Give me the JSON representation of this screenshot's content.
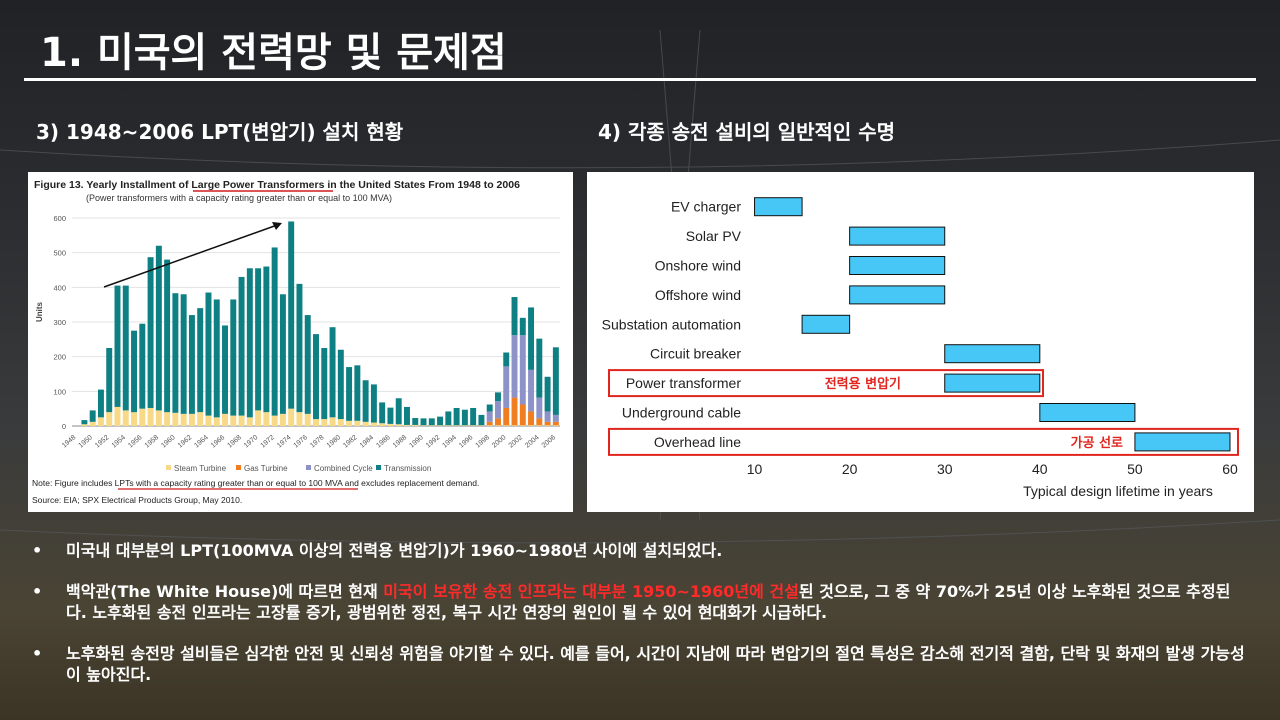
{
  "slide": {
    "title": "1. 미국의 전력망 및 문제점",
    "left_heading": "3)  1948~2006 LPT(변압기) 설치 현황",
    "right_heading": "4)  각종 송전 설비의 일반적인 수명"
  },
  "bullets": [
    {
      "pre": "미국내 대부분의 LPT(100MVA 이상의 전력용 변압기)가 1960~1980년 사이에 설치되었다.",
      "highlight": "",
      "post": ""
    },
    {
      "pre": "백악관(The White House)에 따르면 현재 ",
      "highlight": "미국이 보유한 송전 인프라는 대부분 1950~1960년에 건설",
      "post": "된 것으로, 그 중 약 70%가 25년 이상 노후화된 것으로 추정된다. 노후화된 송전 인프라는 고장률 증가, 광범위한 정전, 복구 시간 연장의 원인이 될 수 있어 현대화가 시급하다."
    },
    {
      "pre": "노후화된 송전망 설비들은 심각한 안전 및 신뢰성 위험을 야기할 수 있다. 예를 들어, 시간이 지남에 따라 변압기의 절연 특성은 감소해 전기적 결함, 단락 및 화재의 발생 가능성이 높아진다.",
      "highlight": "",
      "post": ""
    }
  ],
  "bullet_symbol": "•",
  "colors": {
    "teal": "#0e8083",
    "tan": "#f7d987",
    "orange": "#f07d1f",
    "purple": "#8d93c9",
    "cyan": "#46c7f5",
    "red": "#e0261f"
  },
  "chart_data": [
    {
      "type": "bar",
      "stacked": true,
      "title_pre": "Figure 13. Yearly Installment of ",
      "title_link": "Large Power Transformers",
      "title_post": " in the United States From 1948 to 2006",
      "subtitle": "(Power transformers with a capacity rating greater than or equal to 100 MVA)",
      "ylabel": "Units",
      "ylim": [
        0,
        600
      ],
      "yticks": [
        0,
        100,
        200,
        300,
        400,
        500,
        600
      ],
      "x": [
        1948,
        1949,
        1950,
        1951,
        1952,
        1953,
        1954,
        1955,
        1956,
        1957,
        1958,
        1959,
        1960,
        1961,
        1962,
        1963,
        1964,
        1965,
        1966,
        1967,
        1968,
        1969,
        1970,
        1971,
        1972,
        1973,
        1974,
        1975,
        1976,
        1977,
        1978,
        1979,
        1980,
        1981,
        1982,
        1983,
        1984,
        1985,
        1986,
        1987,
        1988,
        1989,
        1990,
        1991,
        1992,
        1993,
        1994,
        1995,
        1996,
        1997,
        1998,
        1999,
        2000,
        2001,
        2002,
        2003,
        2004,
        2005,
        2006
      ],
      "xtick_labels": [
        "1948",
        "1950",
        "1952",
        "1954",
        "1956",
        "1958",
        "1960",
        "1962",
        "1964",
        "1966",
        "1968",
        "1970",
        "1972",
        "1974",
        "1976",
        "1978",
        "1980",
        "1982",
        "1984",
        "1986",
        "1988",
        "1990",
        "1992",
        "1994",
        "1996",
        "1998",
        "2000",
        "2002",
        "2004",
        "2006"
      ],
      "series": [
        {
          "name": "Steam Turbine",
          "values": [
            0,
            5,
            12,
            25,
            40,
            55,
            45,
            40,
            50,
            52,
            45,
            40,
            38,
            35,
            35,
            40,
            30,
            25,
            35,
            30,
            30,
            25,
            45,
            40,
            30,
            35,
            50,
            40,
            35,
            20,
            20,
            25,
            20,
            15,
            15,
            12,
            10,
            8,
            6,
            5,
            3,
            3,
            2,
            2,
            2,
            2,
            2,
            2,
            2,
            2,
            2,
            2,
            2,
            2,
            2,
            2,
            2,
            2,
            2
          ]
        },
        {
          "name": "Gas Turbine",
          "values": [
            0,
            0,
            0,
            0,
            0,
            0,
            0,
            0,
            0,
            0,
            0,
            0,
            0,
            0,
            0,
            0,
            0,
            0,
            0,
            0,
            0,
            0,
            0,
            0,
            0,
            0,
            0,
            0,
            0,
            0,
            0,
            0,
            0,
            0,
            0,
            0,
            0,
            0,
            0,
            0,
            0,
            0,
            0,
            0,
            0,
            0,
            0,
            0,
            0,
            0,
            10,
            20,
            50,
            80,
            60,
            40,
            20,
            10,
            10
          ]
        },
        {
          "name": "Combined Cycle",
          "values": [
            0,
            0,
            0,
            0,
            0,
            0,
            0,
            0,
            0,
            0,
            0,
            0,
            0,
            0,
            0,
            0,
            0,
            0,
            0,
            0,
            0,
            0,
            0,
            0,
            0,
            0,
            0,
            0,
            0,
            0,
            0,
            0,
            0,
            0,
            0,
            0,
            0,
            0,
            0,
            0,
            0,
            0,
            0,
            0,
            0,
            0,
            0,
            0,
            0,
            0,
            30,
            50,
            120,
            180,
            200,
            120,
            60,
            30,
            20
          ]
        },
        {
          "name": "Transmission",
          "values": [
            0,
            12,
            33,
            80,
            185,
            350,
            360,
            235,
            245,
            435,
            475,
            440,
            345,
            345,
            285,
            300,
            355,
            340,
            255,
            335,
            400,
            430,
            410,
            420,
            485,
            345,
            540,
            370,
            285,
            245,
            205,
            260,
            200,
            155,
            160,
            120,
            110,
            60,
            47,
            75,
            52,
            20,
            20,
            20,
            25,
            40,
            50,
            45,
            50,
            30,
            20,
            25,
            40,
            110,
            50,
            180,
            170,
            100,
            195
          ]
        }
      ],
      "arrow": "up-trend 1950s-1974",
      "note_pre": "Note: Figure includes LPTs ",
      "note_link": "with a capacity rating greater than or equal to 100 MVA",
      "note_post": " and excludes replacement demand.",
      "source": "Source: EIA; SPX Electrical Products Group, May 2010."
    },
    {
      "type": "gantt",
      "xlabel": "Typical design lifetime in years",
      "xlim": [
        5,
        60
      ],
      "xticks": [
        10,
        20,
        30,
        40,
        50,
        60
      ],
      "categories": [
        "EV charger",
        "Solar PV",
        "Onshore wind",
        "Offshore wind",
        "Substation automation",
        "Circuit breaker",
        "Power transformer",
        "Underground cable",
        "Overhead line"
      ],
      "ranges": [
        [
          10,
          15
        ],
        [
          20,
          30
        ],
        [
          20,
          30
        ],
        [
          20,
          30
        ],
        [
          15,
          20
        ],
        [
          30,
          40
        ],
        [
          30,
          40
        ],
        [
          40,
          50
        ],
        [
          50,
          60
        ]
      ],
      "annotations": [
        {
          "row": 6,
          "text": "전력용 변압기"
        },
        {
          "row": 8,
          "text": "가공 선로"
        }
      ]
    }
  ]
}
